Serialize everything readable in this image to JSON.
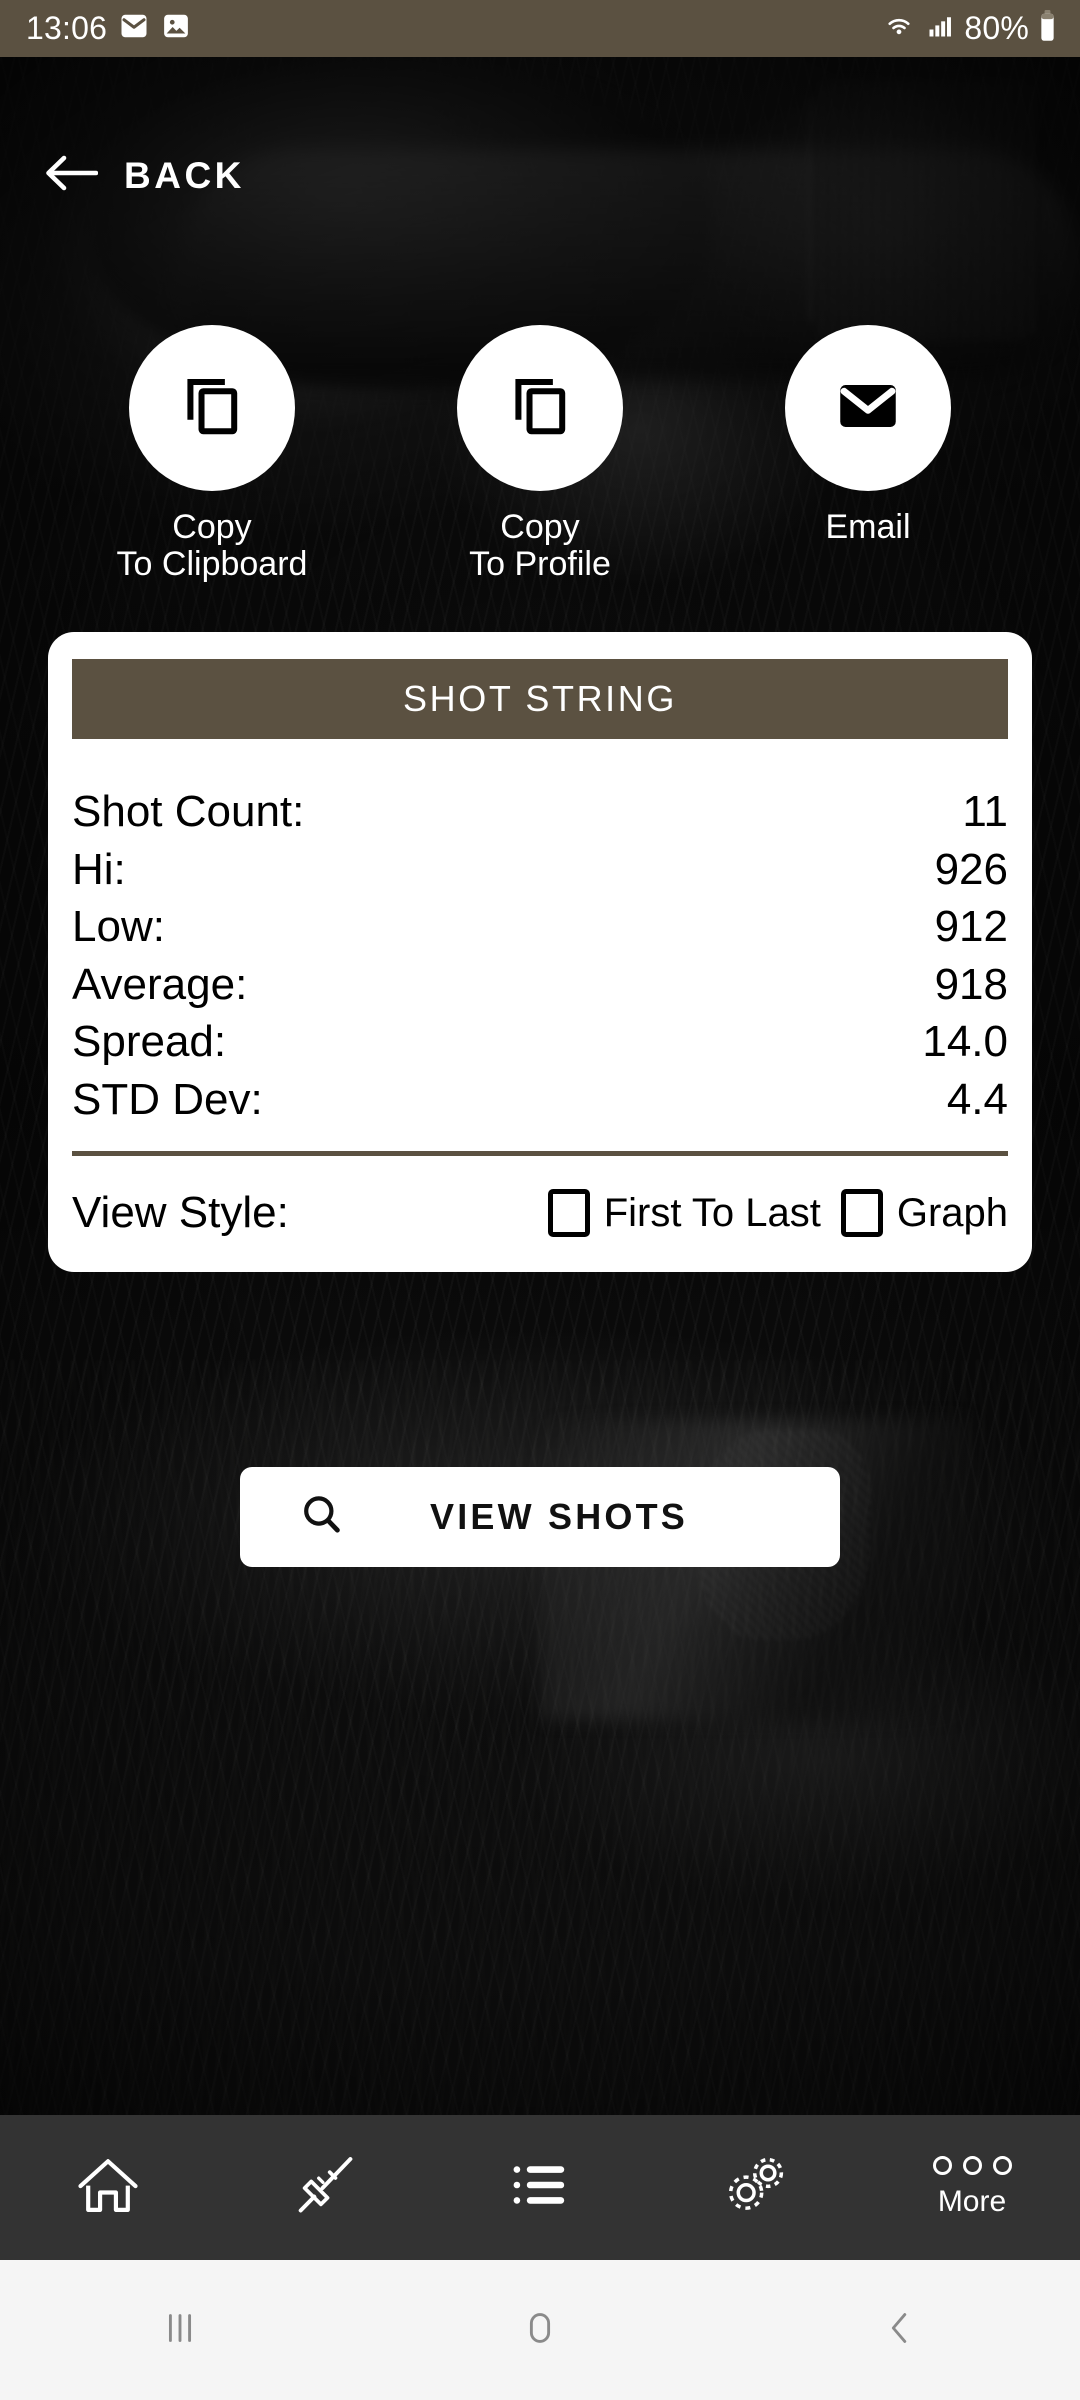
{
  "status_bar": {
    "time": "13:06",
    "battery_percent": "80%",
    "icons": [
      "email-icon",
      "image-icon",
      "wifi-icon",
      "signal-icon",
      "battery-icon"
    ],
    "background_color": "#5b5141"
  },
  "header": {
    "back_label": "BACK",
    "back_icon": "arrow-left-icon"
  },
  "actions": [
    {
      "label": "Copy\nTo Clipboard",
      "icon": "copy-icon"
    },
    {
      "label": "Copy\nTo Profile",
      "icon": "copy-icon"
    },
    {
      "label": "Email",
      "icon": "envelope-icon"
    }
  ],
  "card": {
    "title": "SHOT STRING",
    "title_bg": "#5b5141",
    "stats": [
      {
        "label": "Shot Count:",
        "value": "11"
      },
      {
        "label": "Hi:",
        "value": "926"
      },
      {
        "label": "Low:",
        "value": "912"
      },
      {
        "label": "Average:",
        "value": "918"
      },
      {
        "label": "Spread:",
        "value": "14.0"
      },
      {
        "label": "STD Dev:",
        "value": "4.4"
      }
    ],
    "view_style": {
      "label": "View Style:",
      "options": [
        {
          "label": "First To Last",
          "checked": false
        },
        {
          "label": "Graph",
          "checked": false
        }
      ]
    }
  },
  "view_shots_button": {
    "label": "VIEW SHOTS",
    "icon": "search-icon"
  },
  "bottom_nav": [
    {
      "name": "home",
      "icon": "home-icon",
      "label": ""
    },
    {
      "name": "rifle",
      "icon": "rifle-icon",
      "label": ""
    },
    {
      "name": "list",
      "icon": "list-icon",
      "label": ""
    },
    {
      "name": "settings",
      "icon": "gears-icon",
      "label": ""
    },
    {
      "name": "more",
      "icon": "three-dots-icon",
      "label": "More"
    }
  ],
  "system_nav": {
    "recents": "recents-icon",
    "home": "home-pill-icon",
    "back": "back-chevron-icon"
  }
}
